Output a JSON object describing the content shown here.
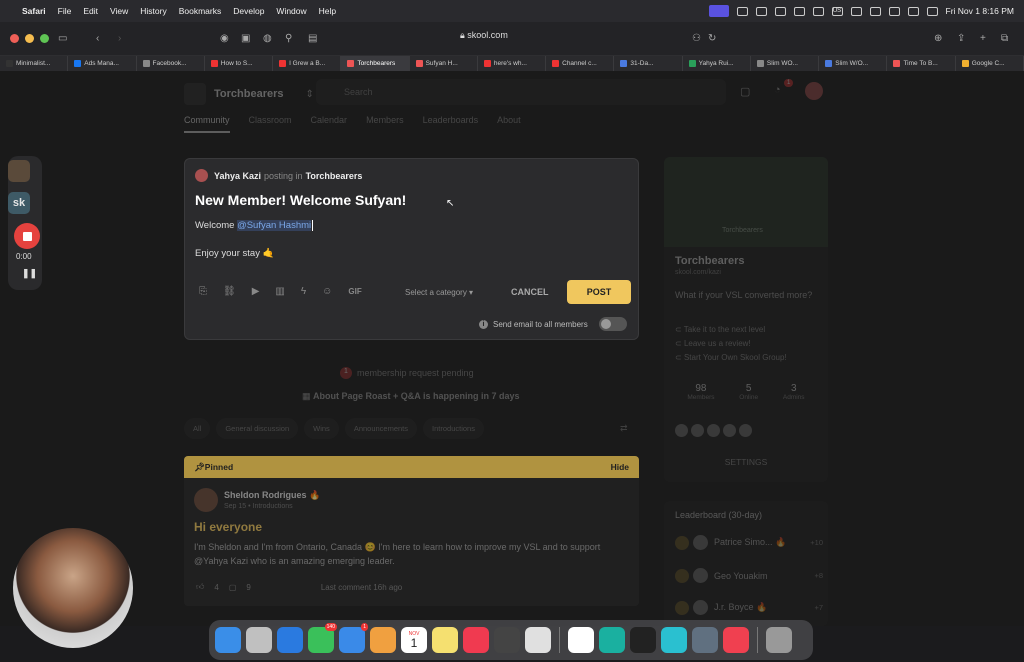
{
  "menubar": {
    "app_name": "Safari",
    "items": [
      "File",
      "Edit",
      "View",
      "History",
      "Bookmarks",
      "Develop",
      "Window",
      "Help"
    ],
    "clock": "Fri Nov 1  8:16 PM",
    "input_source": "US"
  },
  "browser": {
    "url": "skool.com",
    "tabs": [
      {
        "label": "Minimalist...",
        "color": "#333"
      },
      {
        "label": "Ads Mana...",
        "color": "#1877f2"
      },
      {
        "label": "Facebook...",
        "color": "#888"
      },
      {
        "label": "How to S...",
        "color": "#e33"
      },
      {
        "label": "I Grew a B...",
        "color": "#e33"
      },
      {
        "label": "Torchbearers",
        "color": "#e55"
      },
      {
        "label": "Sufyan H...",
        "color": "#e55"
      },
      {
        "label": "here's wh...",
        "color": "#e33"
      },
      {
        "label": "Channel c...",
        "color": "#e33"
      },
      {
        "label": "31-Da...",
        "color": "#4a7ae0"
      },
      {
        "label": "Yahya Rui...",
        "color": "#2aa05a"
      },
      {
        "label": "Slim WO...",
        "color": "#888"
      },
      {
        "label": "Slim W/O...",
        "color": "#4a7ae0"
      },
      {
        "label": "Time To B...",
        "color": "#e55"
      },
      {
        "label": "Google C...",
        "color": "#f0b030"
      }
    ],
    "active_tab": 5
  },
  "community": {
    "name": "Torchbearers",
    "search_placeholder": "Search",
    "notification_count": "1",
    "nav": [
      "Community",
      "Classroom",
      "Calendar",
      "Members",
      "Leaderboards",
      "About"
    ]
  },
  "composer": {
    "author": "Yahya Kazi",
    "posting_in": "posting in",
    "group": "Torchbearers",
    "title": "New Member! Welcome Sufyan!",
    "body_prefix": "Welcome ",
    "mention": "@Sufyan Hashmi",
    "body_line2": "Enjoy your stay 🤙",
    "gif_label": "GIF",
    "category_placeholder": "Select a category",
    "cancel_label": "CANCEL",
    "post_label": "POST",
    "email_label": "Send email to all members"
  },
  "feed": {
    "pending_count": "1",
    "pending_text": "membership request pending",
    "event_text": "About Page Roast + Q&A is happening in 7 days",
    "filters": [
      "All",
      "General discussion",
      "Wins",
      "Announcements",
      "Introductions"
    ],
    "pinned_label": "Pinned",
    "hide_label": "Hide",
    "pinned_post": {
      "author": "Sheldon Rodrigues 🔥",
      "meta": "Sep 15 • Introductions",
      "title": "Hi everyone",
      "text": "I'm Sheldon and I'm from Ontario, Canada 😊 I'm here to learn how to improve my VSL and to support @Yahya Kazi who is an amazing emerging leader.",
      "likes": "4",
      "comments": "9",
      "last_comment": "Last comment 16h ago"
    }
  },
  "sidebar": {
    "image_label": "Torchbearers",
    "name": "Torchbearers",
    "url": "skool.com/kazi",
    "description": "What if your VSL converted more?",
    "links": [
      "Take it to the next level",
      "Leave us a review!",
      "Start Your Own Skool Group!"
    ],
    "stats": [
      {
        "value": "98",
        "label": "Members"
      },
      {
        "value": "5",
        "label": "Online"
      },
      {
        "value": "3",
        "label": "Admins"
      }
    ],
    "settings_label": "SETTINGS"
  },
  "leaderboard": {
    "title": "Leaderboard (30-day)",
    "rows": [
      {
        "rank": "1",
        "name": "Patrice Simo... 🔥",
        "points": "+10"
      },
      {
        "rank": "2",
        "name": "Geo Youakim",
        "points": "+8"
      },
      {
        "rank": "3",
        "name": "J.r. Boyce 🔥",
        "points": "+7"
      }
    ]
  },
  "recorder": {
    "time": "0:00"
  },
  "dock": {
    "apps": [
      "Finder",
      "Launchpad",
      "Safari",
      "Messages",
      "Mail",
      "Photos",
      "Calendar",
      "Notes",
      "Music",
      "Calculator",
      "Preview",
      "Notion",
      "Surfshark",
      "Figma",
      "Canva",
      "Screen",
      "News",
      "Trash"
    ],
    "calendar_month": "NOV",
    "calendar_day": "1",
    "mail_badge": "1",
    "messages_badge": "140"
  }
}
